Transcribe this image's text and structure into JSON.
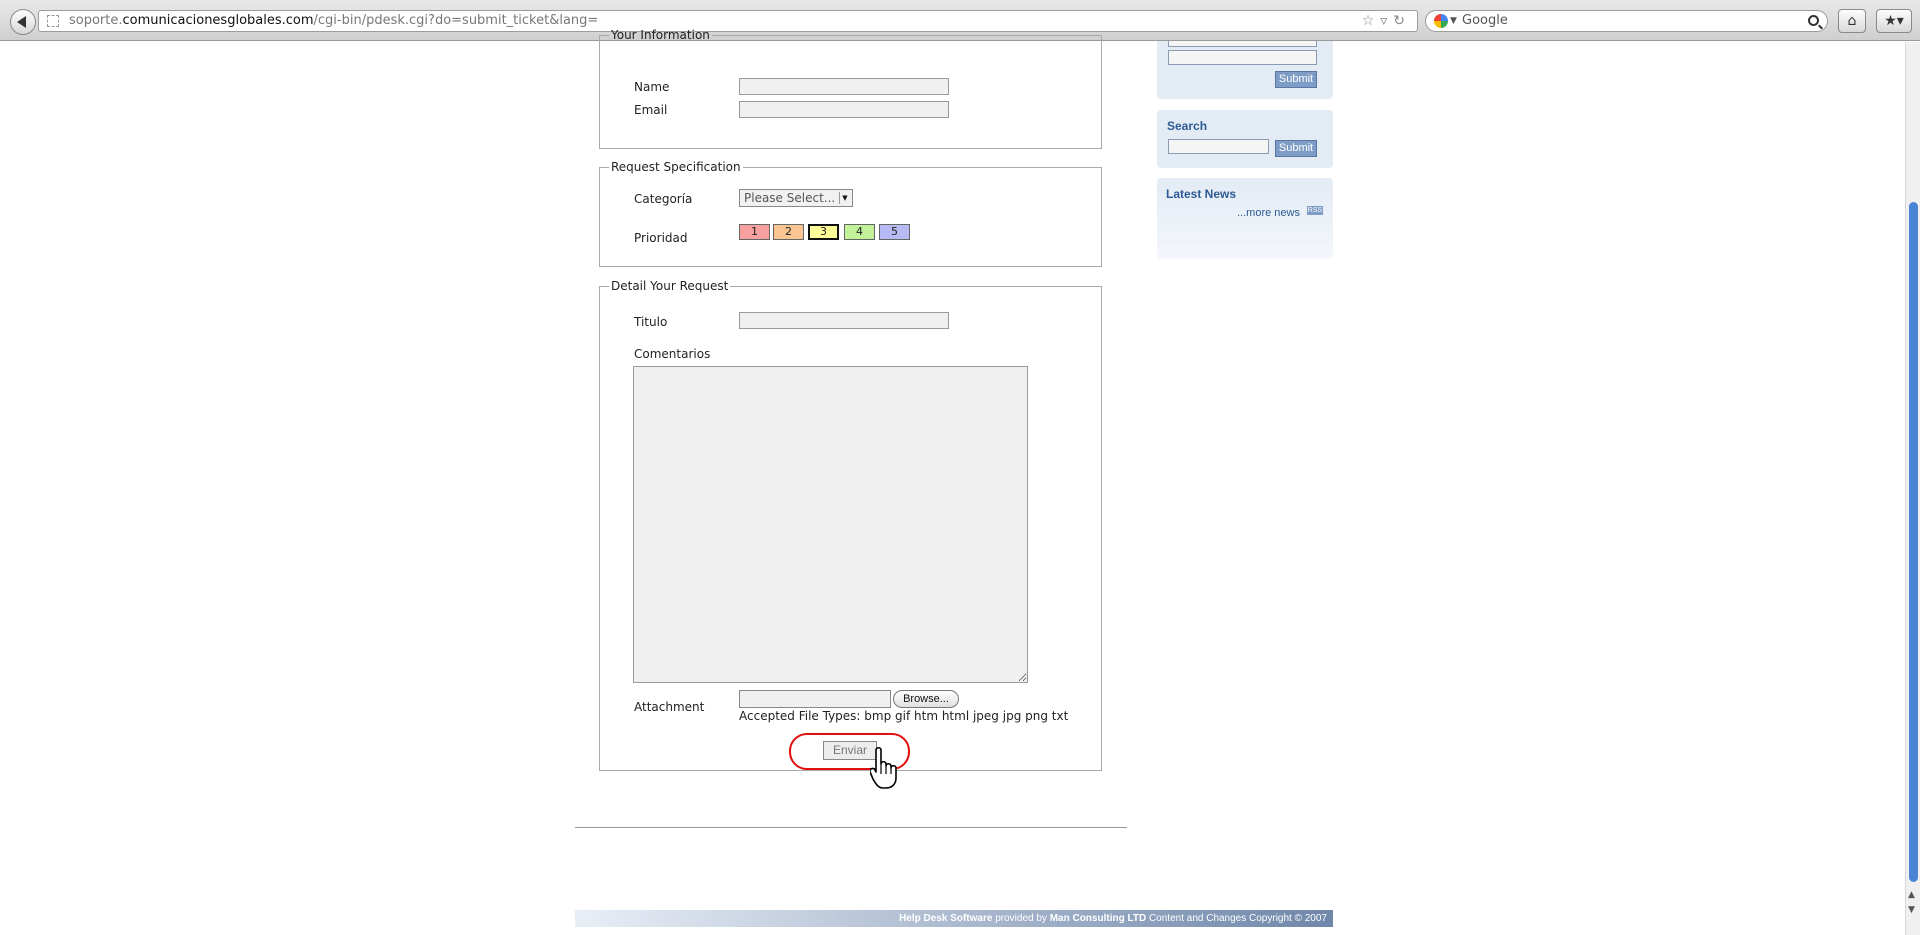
{
  "browser": {
    "url_host": "soporte.",
    "url_domain": "comunicacionesglobales.com",
    "url_path": "/cgi-bin/pdesk.cgi?do=submit_ticket&lang=",
    "search_placeholder": "Google"
  },
  "your_info": {
    "legend": "Your Information",
    "name_label": "Name",
    "email_label": "Email"
  },
  "request_spec": {
    "legend": "Request Specification",
    "category_label": "Categoría",
    "category_value": "Please Select...",
    "priority_label": "Prioridad",
    "priorities": [
      "1",
      "2",
      "3",
      "4",
      "5"
    ],
    "priority_colors": [
      "#f7a0a0",
      "#f9c590",
      "#fdfd9a",
      "#c2f39a",
      "#b8baf4"
    ]
  },
  "detail": {
    "legend": "Detail Your Request",
    "title_label": "Titulo",
    "comments_label": "Comentarios",
    "attachment_label": "Attachment",
    "browse_label": "Browse...",
    "accepted_types": "Accepted File Types: bmp gif htm html jpeg jpg png txt",
    "submit_label": "Enviar"
  },
  "sidebar": {
    "submit_label": "Submit",
    "search_title": "Search",
    "search_submit_label": "Submit",
    "news_title": "Latest News",
    "more_news": "...more news",
    "rss_badge": "RSS"
  },
  "footer": {
    "product": "Help Desk Software",
    "provided_by": " provided by ",
    "company": "Man Consulting LTD",
    "copyright": " Content and Changes Copyright © 2007"
  }
}
